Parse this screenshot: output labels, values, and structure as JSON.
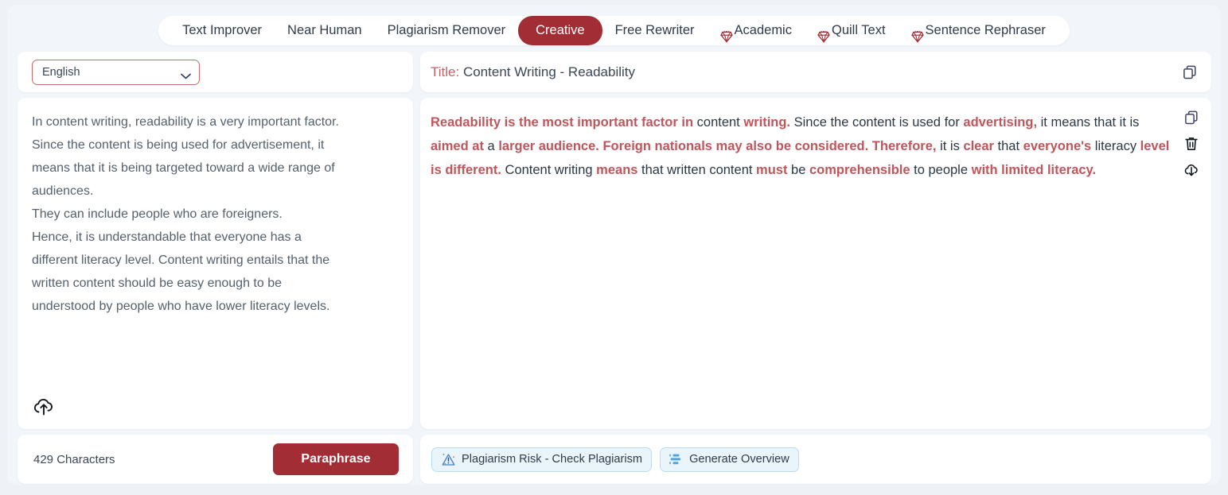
{
  "tabs": [
    {
      "label": "Text Improver",
      "active": false,
      "gem": false
    },
    {
      "label": "Near Human",
      "active": false,
      "gem": false
    },
    {
      "label": "Plagiarism Remover",
      "active": false,
      "gem": false
    },
    {
      "label": "Creative",
      "active": true,
      "gem": false
    },
    {
      "label": "Free Rewriter",
      "active": false,
      "gem": false
    },
    {
      "label": "Academic",
      "active": false,
      "gem": true
    },
    {
      "label": "Quill Text",
      "active": false,
      "gem": true
    },
    {
      "label": "Sentence Rephraser",
      "active": false,
      "gem": true
    }
  ],
  "left": {
    "language_select": {
      "value": "English",
      "icon": "chevron-down-icon"
    },
    "input_text": "In content writing, readability is a very important factor.\nSince the content is being used for advertisement, it\nmeans that it is being targeted toward a wide range of\naudiences.\nThey can include people who are foreigners.\nHence, it is understandable that everyone has a\ndifferent literacy level. Content writing entails that the\nwritten content should be easy enough to be\nunderstood by people who have lower literacy levels.",
    "upload_icon": "upload-cloud-icon",
    "character_count": "429 Characters",
    "paraphrase_button": "Paraphrase"
  },
  "right": {
    "title_label": "Title:",
    "title_value": "Content Writing - Readability",
    "header_copy_icon": "copy-icon",
    "actions": [
      {
        "icon": "copy-icon",
        "name": "copy-output-button"
      },
      {
        "icon": "trash-icon",
        "name": "delete-output-button"
      },
      {
        "icon": "download-cloud-icon",
        "name": "download-output-button"
      }
    ],
    "output_segments": [
      {
        "text": "Readability is the most important factor in",
        "highlight": true
      },
      {
        "text": " content ",
        "highlight": false
      },
      {
        "text": "writing.",
        "highlight": true
      },
      {
        "text": " Since the content is used for ",
        "highlight": false
      },
      {
        "text": "advertising,",
        "highlight": true
      },
      {
        "text": " it means that it is ",
        "highlight": false
      },
      {
        "text": "aimed at",
        "highlight": true
      },
      {
        "text": " a ",
        "highlight": false
      },
      {
        "text": "larger audience. Foreign nationals may also be considered. Therefore,",
        "highlight": true
      },
      {
        "text": " it is ",
        "highlight": false
      },
      {
        "text": "clear",
        "highlight": true
      },
      {
        "text": " that ",
        "highlight": false
      },
      {
        "text": "everyone's",
        "highlight": true
      },
      {
        "text": " literacy ",
        "highlight": false
      },
      {
        "text": "level is different.",
        "highlight": true
      },
      {
        "text": " Content writing ",
        "highlight": false
      },
      {
        "text": "means",
        "highlight": true
      },
      {
        "text": " that written content ",
        "highlight": false
      },
      {
        "text": "must",
        "highlight": true
      },
      {
        "text": " be ",
        "highlight": false
      },
      {
        "text": "comprehensible",
        "highlight": true
      },
      {
        "text": " to people ",
        "highlight": false
      },
      {
        "text": "with limited literacy.",
        "highlight": true
      }
    ],
    "footer_buttons": [
      {
        "label": "Plagiarism Risk - Check Plagiarism",
        "icon": "warning-triangle-icon",
        "name": "check-plagiarism-button"
      },
      {
        "label": "Generate Overview",
        "icon": "bar-list-icon",
        "name": "generate-overview-button"
      }
    ]
  },
  "colors": {
    "accent": "#a32d34",
    "highlight": "#c0565c",
    "page_bg": "#eef2f7",
    "panel_bg": "#ffffff",
    "pill_border": "#bcddee"
  }
}
